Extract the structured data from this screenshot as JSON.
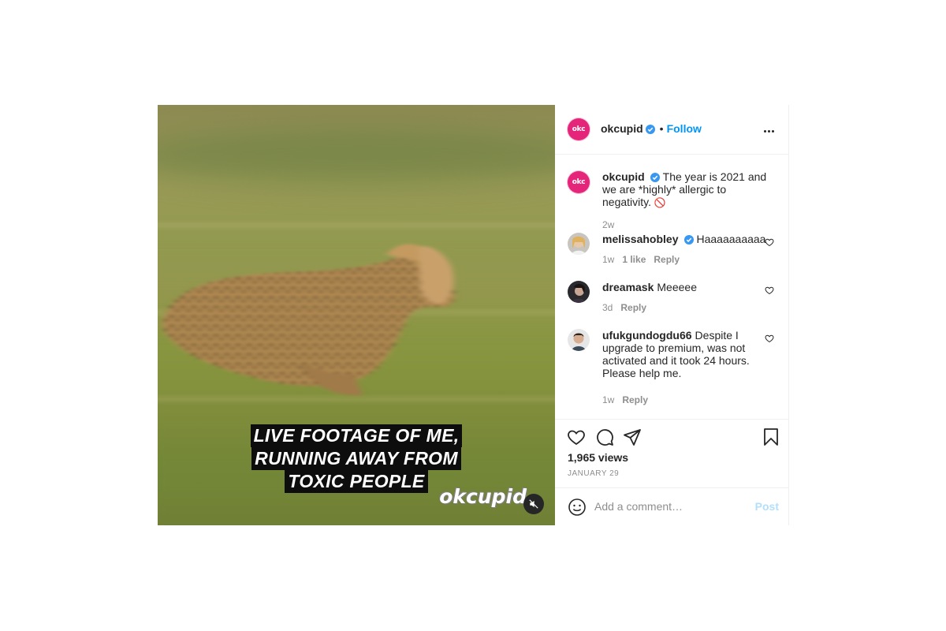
{
  "media": {
    "caption_lines": [
      "LIVE FOOTAGE OF ME,",
      "RUNNING AWAY FROM",
      "TOXIC PEOPLE"
    ],
    "watermark": "okcupid",
    "mute_icon": "speaker-muted-icon"
  },
  "header": {
    "username": "okcupid",
    "avatar_text": "okc",
    "separator": "•",
    "follow_label": "Follow",
    "more_icon": "more-horizontal-icon"
  },
  "post_caption": {
    "username": "okcupid",
    "avatar_text": "okc",
    "text": "The year is 2021 and we are *highly* allergic to negativity.",
    "emoji": "🚫",
    "time": "2w"
  },
  "comments": [
    {
      "username": "melissahobley",
      "verified": true,
      "text": "Haaaaaaaaaa",
      "time": "1w",
      "likes": "1 like",
      "reply": "Reply"
    },
    {
      "username": "dreamask",
      "verified": false,
      "text": "Meeeee",
      "time": "3d",
      "reply": "Reply"
    },
    {
      "username": "ufukgundogdu66",
      "verified": false,
      "text": "Despite I upgrade to premium, was not activated and it took 24 hours. Please help me.",
      "time": "1w",
      "reply": "Reply"
    }
  ],
  "actions": {
    "icons": [
      "heart-icon",
      "comment-icon",
      "share-icon",
      "bookmark-icon"
    ],
    "views": "1,965 views",
    "date": "JANUARY 29"
  },
  "add_comment": {
    "placeholder": "Add a comment…",
    "post_label": "Post",
    "emoji_icon": "smiley-icon"
  },
  "colors": {
    "brand_pink": "#e5257a",
    "link_blue": "#0095f6",
    "post_disabled": "#b2dffc",
    "muted_text": "#8e8e8e"
  }
}
